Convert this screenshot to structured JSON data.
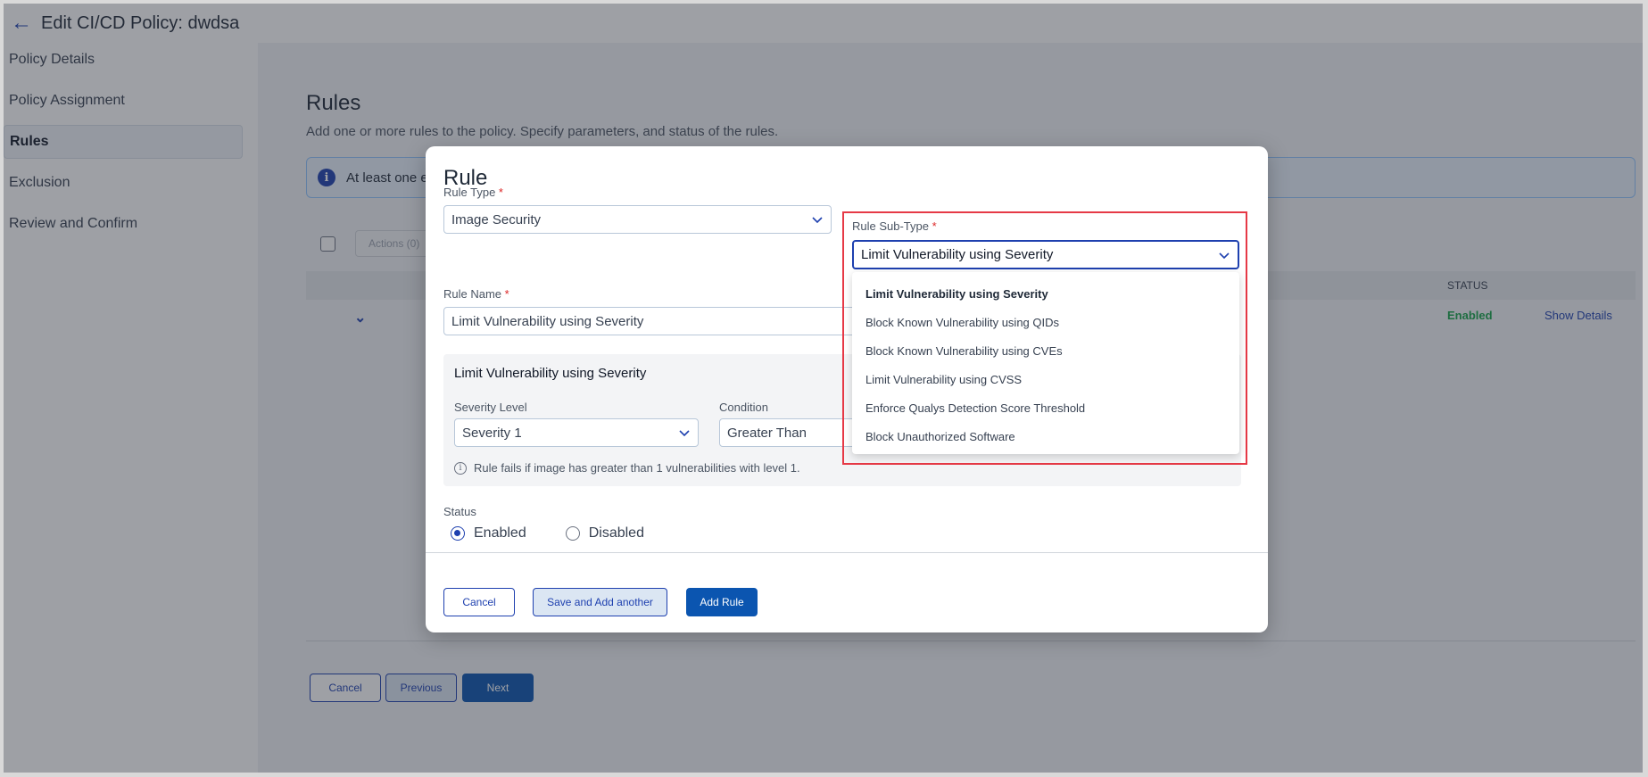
{
  "header": {
    "back_icon": "arrow-left-icon",
    "title": "Edit CI/CD Policy: dwdsa"
  },
  "sidebar": {
    "items": [
      {
        "label": "Policy Details",
        "active": false
      },
      {
        "label": "Policy Assignment",
        "active": false
      },
      {
        "label": "Rules",
        "active": true
      },
      {
        "label": "Exclusion",
        "active": false
      },
      {
        "label": "Review and Confirm",
        "active": false
      }
    ]
  },
  "main": {
    "title": "Rules",
    "description": "Add one or more rules to the policy. Specify parameters, and status of the rules.",
    "info_banner": {
      "icon": "info-icon",
      "text": "At least one en"
    },
    "toolbar": {
      "actions_label": "Actions (0)"
    },
    "table": {
      "columns": {
        "status": "STATUS"
      },
      "rows": [
        {
          "status": "Enabled",
          "show_details": "Show Details"
        }
      ]
    },
    "footer": {
      "cancel": "Cancel",
      "previous": "Previous",
      "next": "Next"
    }
  },
  "modal": {
    "title": "Rule",
    "rule_type": {
      "label": "Rule Type",
      "required_mark": "*",
      "value": "Image Security"
    },
    "rule_sub_type": {
      "label": "Rule Sub-Type",
      "required_mark": "*",
      "value": "Limit Vulnerability using Severity",
      "options": [
        "Limit Vulnerability using Severity",
        "Block Known Vulnerability using QIDs",
        "Block Known Vulnerability using CVEs",
        "Limit Vulnerability using CVSS",
        "Enforce Qualys Detection Score Threshold",
        "Block Unauthorized Software"
      ],
      "selected_index": 0
    },
    "rule_name": {
      "label": "Rule Name",
      "required_mark": "*",
      "value": "Limit Vulnerability using Severity"
    },
    "parameters": {
      "title": "Limit Vulnerability using Severity",
      "severity_level": {
        "label": "Severity Level",
        "value": "Severity 1"
      },
      "condition": {
        "label": "Condition",
        "value": "Greater Than"
      },
      "hint": "Rule fails if image has greater than 1 vulnerabilities with level 1."
    },
    "status": {
      "label": "Status",
      "enabled": "Enabled",
      "disabled": "Disabled",
      "selected": "Enabled"
    },
    "buttons": {
      "cancel": "Cancel",
      "save_add_another": "Save and Add another",
      "add_rule": "Add Rule"
    }
  },
  "colors": {
    "primary": "#0b55b0",
    "highlight": "#e63946",
    "enabled_green": "#16a34a"
  }
}
